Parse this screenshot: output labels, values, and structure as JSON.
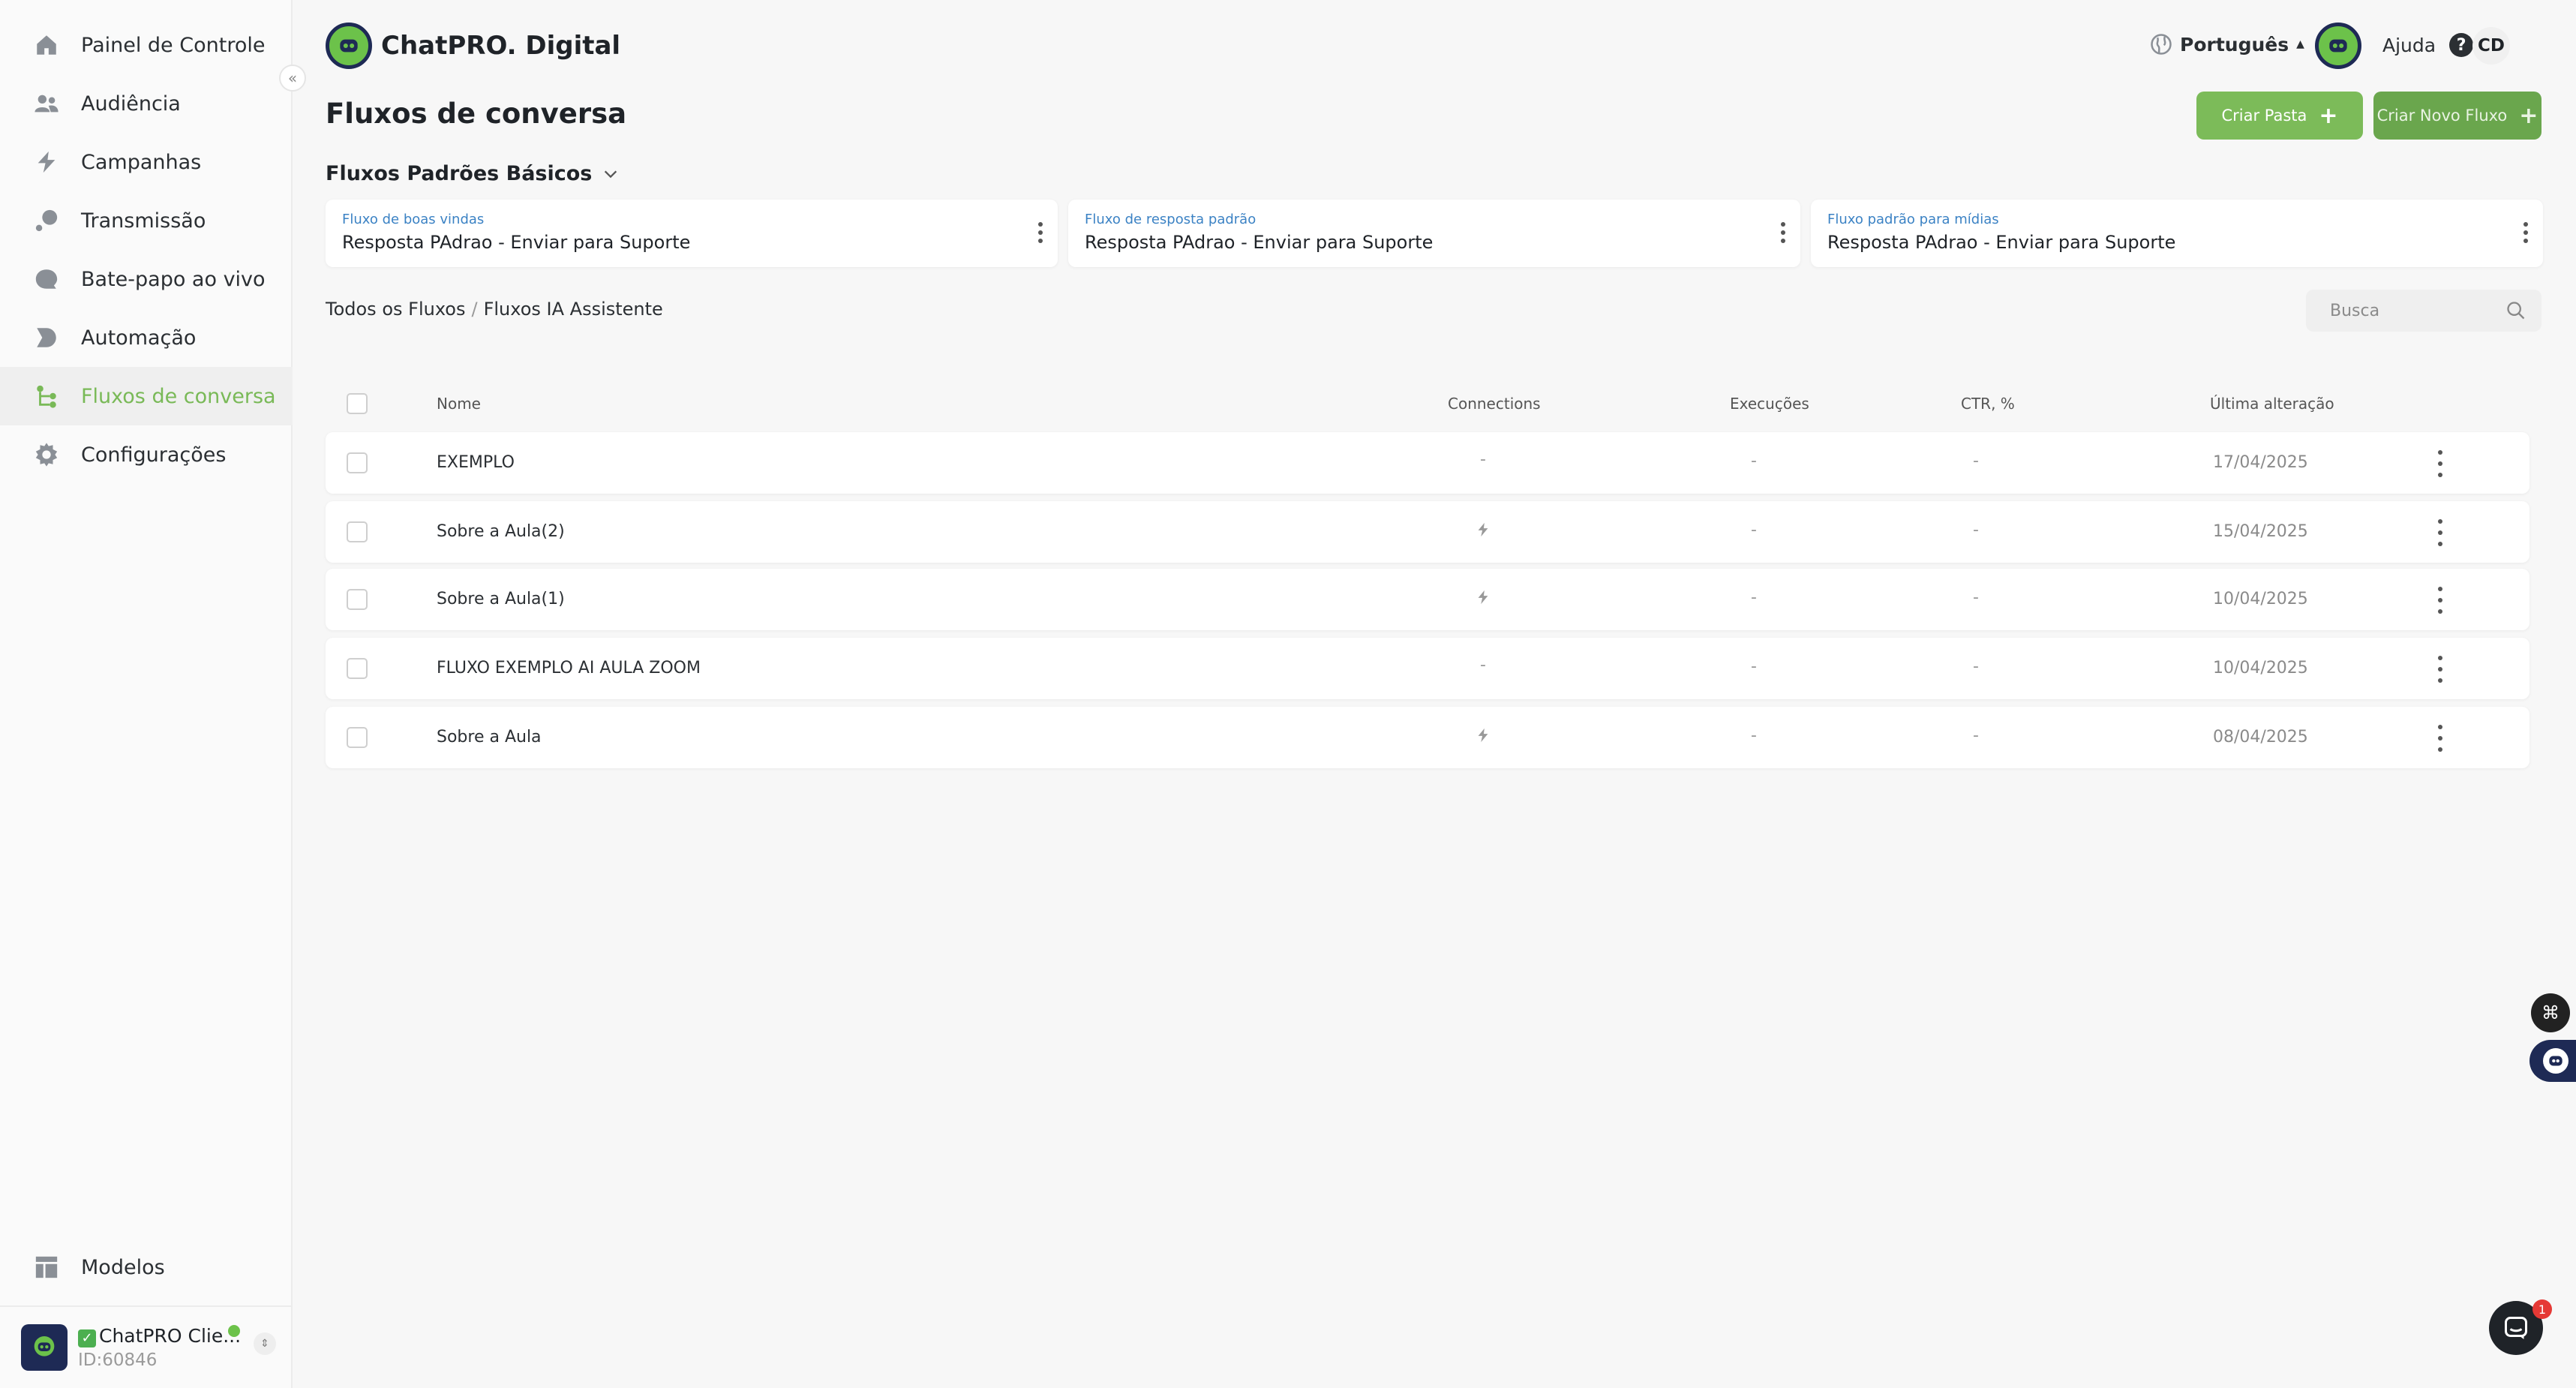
{
  "colors": {
    "accent": "#7cbb59",
    "brand_navy": "#1e2a55",
    "link_blue": "#3b82c4",
    "online": "#6cc24a"
  },
  "sidebar": {
    "items": [
      {
        "label": "Painel de Controle",
        "icon": "home-icon"
      },
      {
        "label": "Audiência",
        "icon": "users-icon"
      },
      {
        "label": "Campanhas",
        "icon": "lightning-icon"
      },
      {
        "label": "Transmissão",
        "icon": "broadcast-icon"
      },
      {
        "label": "Bate-papo ao vivo",
        "icon": "chat-bubble-icon"
      },
      {
        "label": "Automação",
        "icon": "automation-icon"
      },
      {
        "label": "Fluxos de conversa",
        "icon": "flow-icon",
        "active": true
      },
      {
        "label": "Configurações",
        "icon": "gear-icon"
      }
    ],
    "models_label": "Modelos",
    "account": {
      "name": "ChatPRO Clie...",
      "id": "ID:60846",
      "status_icon": "check-icon"
    }
  },
  "header": {
    "brand": "ChatPRO. Digital",
    "language": "Português",
    "help": "Ajuda",
    "help_symbol": "?",
    "user_initials": "CD"
  },
  "page": {
    "title": "Fluxos de conversa",
    "create_folder": "Criar Pasta",
    "create_flow": "Criar Novo Fluxo",
    "plus": "+"
  },
  "defaults": {
    "title": "Fluxos Padrões Básicos",
    "cards": [
      {
        "label": "Fluxo de boas vindas",
        "value": "Resposta PAdrao - Enviar para Suporte"
      },
      {
        "label": "Fluxo de resposta padrão",
        "value": "Resposta PAdrao - Enviar para Suporte"
      },
      {
        "label": "Fluxo padrão para mídias",
        "value": "Resposta PAdrao - Enviar para Suporte"
      }
    ]
  },
  "breadcrumb": {
    "root": "Todos os Fluxos",
    "separator": "/",
    "current": "Fluxos IA Assistente"
  },
  "search": {
    "placeholder": "Busca"
  },
  "table": {
    "headers": {
      "name": "Nome",
      "connections": "Connections",
      "executions": "Execuções",
      "ctr": "CTR, %",
      "last_change": "Última alteração"
    },
    "rows": [
      {
        "name": "EXEMPLO",
        "connections": "-",
        "connected": false,
        "executions": "-",
        "ctr": "-",
        "date": "17/04/2025"
      },
      {
        "name": "Sobre a Aula(2)",
        "connections": "",
        "connected": true,
        "executions": "-",
        "ctr": "-",
        "date": "15/04/2025"
      },
      {
        "name": "Sobre a Aula(1)",
        "connections": "",
        "connected": true,
        "executions": "-",
        "ctr": "-",
        "date": "10/04/2025"
      },
      {
        "name": "FLUXO EXEMPLO AI AULA ZOOM",
        "connections": "-",
        "connected": false,
        "executions": "-",
        "ctr": "-",
        "date": "10/04/2025"
      },
      {
        "name": "Sobre a Aula",
        "connections": "",
        "connected": true,
        "executions": "-",
        "ctr": "-",
        "date": "08/04/2025"
      }
    ]
  },
  "floating": {
    "chat_badge": "1"
  }
}
